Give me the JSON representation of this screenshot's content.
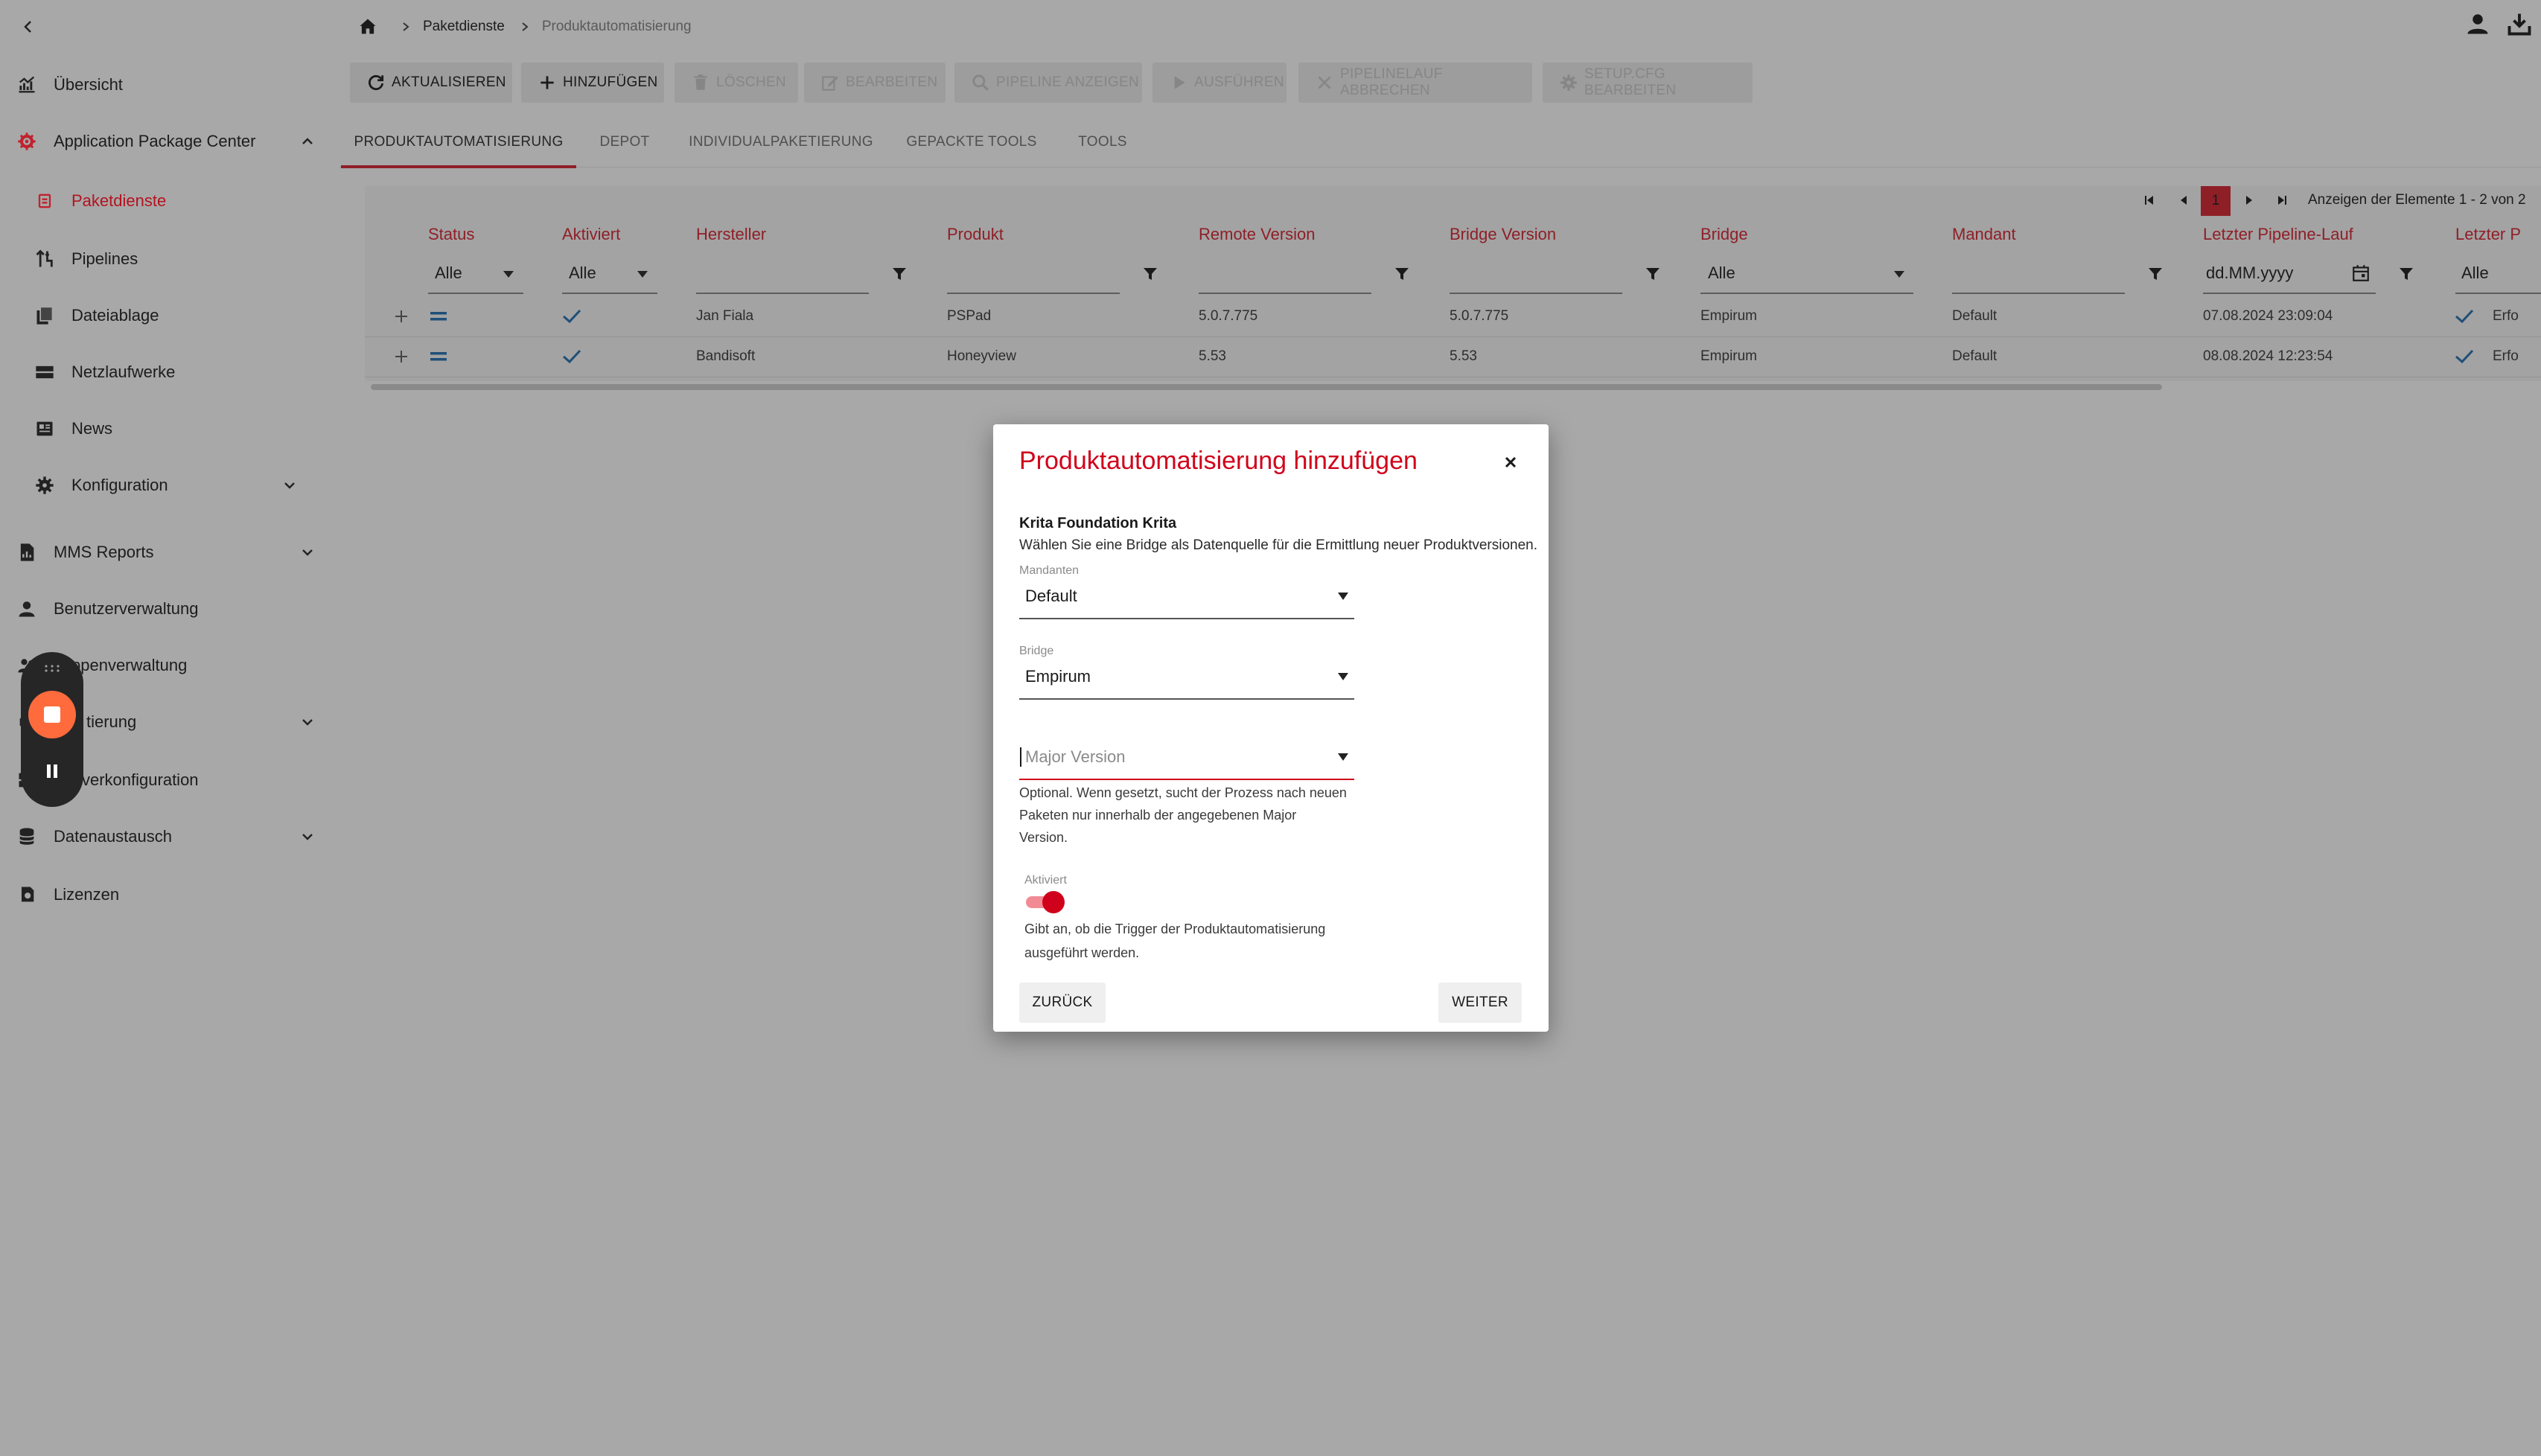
{
  "breadcrumb": {
    "items": [
      "Paketdienste",
      "Produktautomatisierung"
    ]
  },
  "sidebar": {
    "items": [
      {
        "label": "Übersicht",
        "icon": "chart-icon"
      },
      {
        "label": "Application Package Center",
        "icon": "package-gear-icon"
      },
      {
        "label": "Paketdienste",
        "icon": "package-list-icon"
      },
      {
        "label": "Pipelines",
        "icon": "pipeline-icon"
      },
      {
        "label": "Dateiablage",
        "icon": "files-icon"
      },
      {
        "label": "Netzlaufwerke",
        "icon": "drive-icon"
      },
      {
        "label": "News",
        "icon": "news-icon"
      },
      {
        "label": "Konfiguration",
        "icon": "gear-icon"
      },
      {
        "label": "MMS Reports",
        "icon": "report-icon"
      },
      {
        "label": "Benutzerverwaltung",
        "icon": "user-icon"
      },
      {
        "label": "ppenverwaltung",
        "icon": "group-icon"
      },
      {
        "label": "tierung",
        "icon": "deploy-icon"
      },
      {
        "label": "verkonfiguration",
        "icon": "server-icon"
      },
      {
        "label": "Datenaustausch",
        "icon": "database-icon"
      },
      {
        "label": "Lizenzen",
        "icon": "license-icon"
      }
    ],
    "active_index": 2
  },
  "toolbar": {
    "buttons": [
      {
        "label": "AKTUALISIEREN",
        "enabled": true
      },
      {
        "label": "HINZUFÜGEN",
        "enabled": true
      },
      {
        "label": "LÖSCHEN",
        "enabled": false
      },
      {
        "label": "BEARBEITEN",
        "enabled": false
      },
      {
        "label": "PIPELINE ANZEIGEN",
        "enabled": false
      },
      {
        "label": "AUSFÜHREN",
        "enabled": false
      },
      {
        "label": "PIPELINELAUF ABBRECHEN",
        "enabled": false
      },
      {
        "label": "SETUP.CFG BEARBEITEN",
        "enabled": false
      }
    ]
  },
  "tabs": [
    "PRODUKTAUTOMATISIERUNG",
    "DEPOT",
    "INDIVIDUALPAKETIERUNG",
    "GEPACKTE TOOLS",
    "TOOLS"
  ],
  "pager": {
    "current_page": "1",
    "summary": "Anzeigen der Elemente 1 - 2 von 2"
  },
  "table": {
    "columns": [
      "Status",
      "Aktiviert",
      "Hersteller",
      "Produkt",
      "Remote Version",
      "Bridge Version",
      "Bridge",
      "Mandant",
      "Letzter Pipeline-Lauf",
      "Letzter P"
    ],
    "filters": {
      "status": "Alle",
      "aktiviert": "Alle",
      "bridge": "Alle",
      "date_placeholder": "dd.MM.yyyy",
      "last": "Alle"
    },
    "rows": [
      {
        "hersteller": "Jan Fiala",
        "produkt": "PSPad",
        "remote_version": "5.0.7.775",
        "bridge_version": "5.0.7.775",
        "bridge": "Empirum",
        "mandant": "Default",
        "letzter_lauf": "07.08.2024 23:09:04",
        "letzter_status": "Erfo"
      },
      {
        "hersteller": "Bandisoft",
        "produkt": "Honeyview",
        "remote_version": "5.53",
        "bridge_version": "5.53",
        "bridge": "Empirum",
        "mandant": "Default",
        "letzter_lauf": "08.08.2024 12:23:54",
        "letzter_status": "Erfo"
      }
    ]
  },
  "modal": {
    "title": "Produktautomatisierung hinzufügen",
    "product_name": "Krita Foundation Krita",
    "description": "Wählen Sie eine Bridge als Datenquelle für die Ermittlung neuer Produktversionen.",
    "mandanten_label": "Mandanten",
    "mandanten_value": "Default",
    "bridge_label": "Bridge",
    "bridge_value": "Empirum",
    "major_version_placeholder": "Major Version",
    "major_version_hint_1": "Optional. Wenn gesetzt, sucht der Prozess nach neuen",
    "major_version_hint_2": "Paketen nur innerhalb der angegebenen Major",
    "major_version_hint_3": "Version.",
    "aktiviert_label": "Aktiviert",
    "aktiviert_on": true,
    "aktiviert_hint_1": "Gibt an, ob die Trigger der Produktautomatisierung",
    "aktiviert_hint_2": "ausgeführt werden.",
    "back_label": "ZURÜCK",
    "next_label": "WEITER"
  },
  "colors": {
    "accent": "#d0021b",
    "accent_dim": "#8f1f27",
    "check": "#1f4f78",
    "record": "#ff6b3d"
  }
}
